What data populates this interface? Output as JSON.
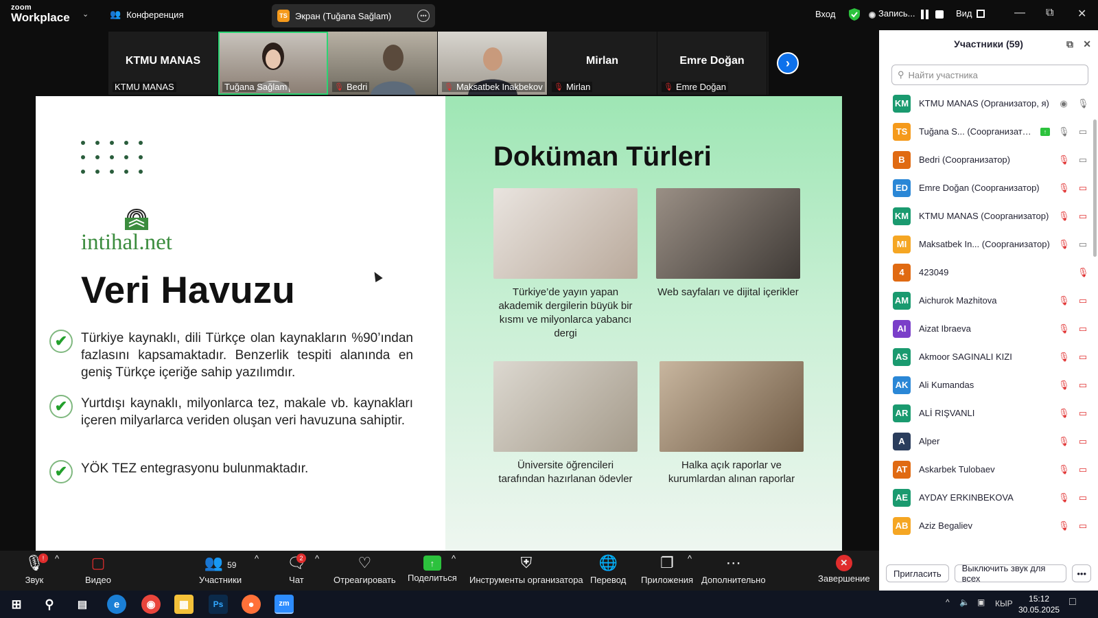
{
  "app": {
    "logo_small": "zoom",
    "logo_big": "Workplace",
    "conference": "Конференция",
    "screen_tab": "Экран (Tuğana Sağlam)",
    "screen_badge": "TS"
  },
  "topright": {
    "login": "Вход",
    "recording": "Запись...",
    "view": "Вид"
  },
  "video_strip": [
    {
      "big": "KTMU MANAS",
      "name": "KTMU MANAS",
      "muted": false
    },
    {
      "big": "",
      "name": "Tuğana Sağlam",
      "muted": false
    },
    {
      "big": "",
      "name": "Bedri",
      "muted": true
    },
    {
      "big": "",
      "name": "Maksatbek Inakbekov",
      "muted": true
    },
    {
      "big": "Mirlan",
      "name": "Mirlan",
      "muted": true
    },
    {
      "big": "Emre Doğan",
      "name": "Emre Doğan",
      "muted": true
    }
  ],
  "slide": {
    "brand": "intihal.net",
    "title": "Veri Havuzu",
    "bullets": [
      "Türkiye kaynaklı, dili Türkçe olan kaynakların %90’ından fazlasını kapsamaktadır. Benzerlik tespiti alanında en geniş Türkçe içeriğe sahip yazılımdır.",
      "Yurtdışı kaynaklı, milyonlarca tez, makale vb. kaynakları içeren milyarlarca veriden oluşan veri havuzuna sahiptir.",
      "YÖK TEZ entegrasyonu bulunmaktadır."
    ],
    "doc_title": "Doküman Türleri",
    "cards": [
      "Türkiye’de yayın yapan akademik dergilerin büyük bir kısmı ve milyonlarca yabancı dergi",
      "Web sayfaları ve dijital içerikler",
      "Üniversite öğrencileri tarafından hazırlanan ödevler",
      "Halka açık raporlar ve kurumlardan alınan raporlar"
    ]
  },
  "participants": {
    "header": "Участники (59)",
    "search_placeholder": "Найти участника",
    "list": [
      {
        "initials": "KM",
        "name": "KTMU MANAS (Организатор, я)",
        "color": "#1a9a6f"
      },
      {
        "initials": "TS",
        "name": "Tuğana S... (Соорганизатор)",
        "color": "#f59a1b"
      },
      {
        "initials": "B",
        "name": "Bedri (Соорганизатор)",
        "color": "#e06a12"
      },
      {
        "initials": "ED",
        "name": "Emre Doğan (Соорганизатор)",
        "color": "#2a87d6"
      },
      {
        "initials": "KM",
        "name": "KTMU MANAS (Соорганизатор)",
        "color": "#1a9a6f"
      },
      {
        "initials": "MI",
        "name": "Maksatbek In... (Соорганизатор)",
        "color": "#f5a623"
      },
      {
        "initials": "4",
        "name": "423049",
        "color": "#e06a12"
      },
      {
        "initials": "AM",
        "name": "Aichurok Mazhitova",
        "color": "#1a9a6f"
      },
      {
        "initials": "AI",
        "name": "Aizat Ibraeva",
        "color": "#7a3fc9"
      },
      {
        "initials": "AS",
        "name": "Akmoor SAGINALI KIZI",
        "color": "#1a9a6f"
      },
      {
        "initials": "AK",
        "name": "Ali Kumandas",
        "color": "#2a87d6"
      },
      {
        "initials": "AR",
        "name": "ALİ RIŞVANLI",
        "color": "#1a9a6f"
      },
      {
        "initials": "A",
        "name": "Alper",
        "color": "#2a3d5c"
      },
      {
        "initials": "AT",
        "name": "Askarbek Tulobaev",
        "color": "#e06a12"
      },
      {
        "initials": "AE",
        "name": "AYDAY ERKINBEKOVA",
        "color": "#1a9a6f"
      },
      {
        "initials": "AB",
        "name": "Aziz Begaliev",
        "color": "#f5a623"
      }
    ],
    "invite": "Пригласить",
    "mute_all": "Выключить звук для всех"
  },
  "toolbar": {
    "audio": "Звук",
    "video": "Видео",
    "participants": "Участники",
    "participants_count": "59",
    "chat": "Чат",
    "chat_badge": "2",
    "react": "Отреагировать",
    "share": "Поделиться",
    "host_tools": "Инструменты организатора",
    "translate": "Перевод",
    "apps": "Приложения",
    "more": "Дополнительно",
    "end": "Завершение"
  },
  "taskbar": {
    "lang": "КЫР",
    "time": "15:12",
    "date": "30.05.2025"
  }
}
